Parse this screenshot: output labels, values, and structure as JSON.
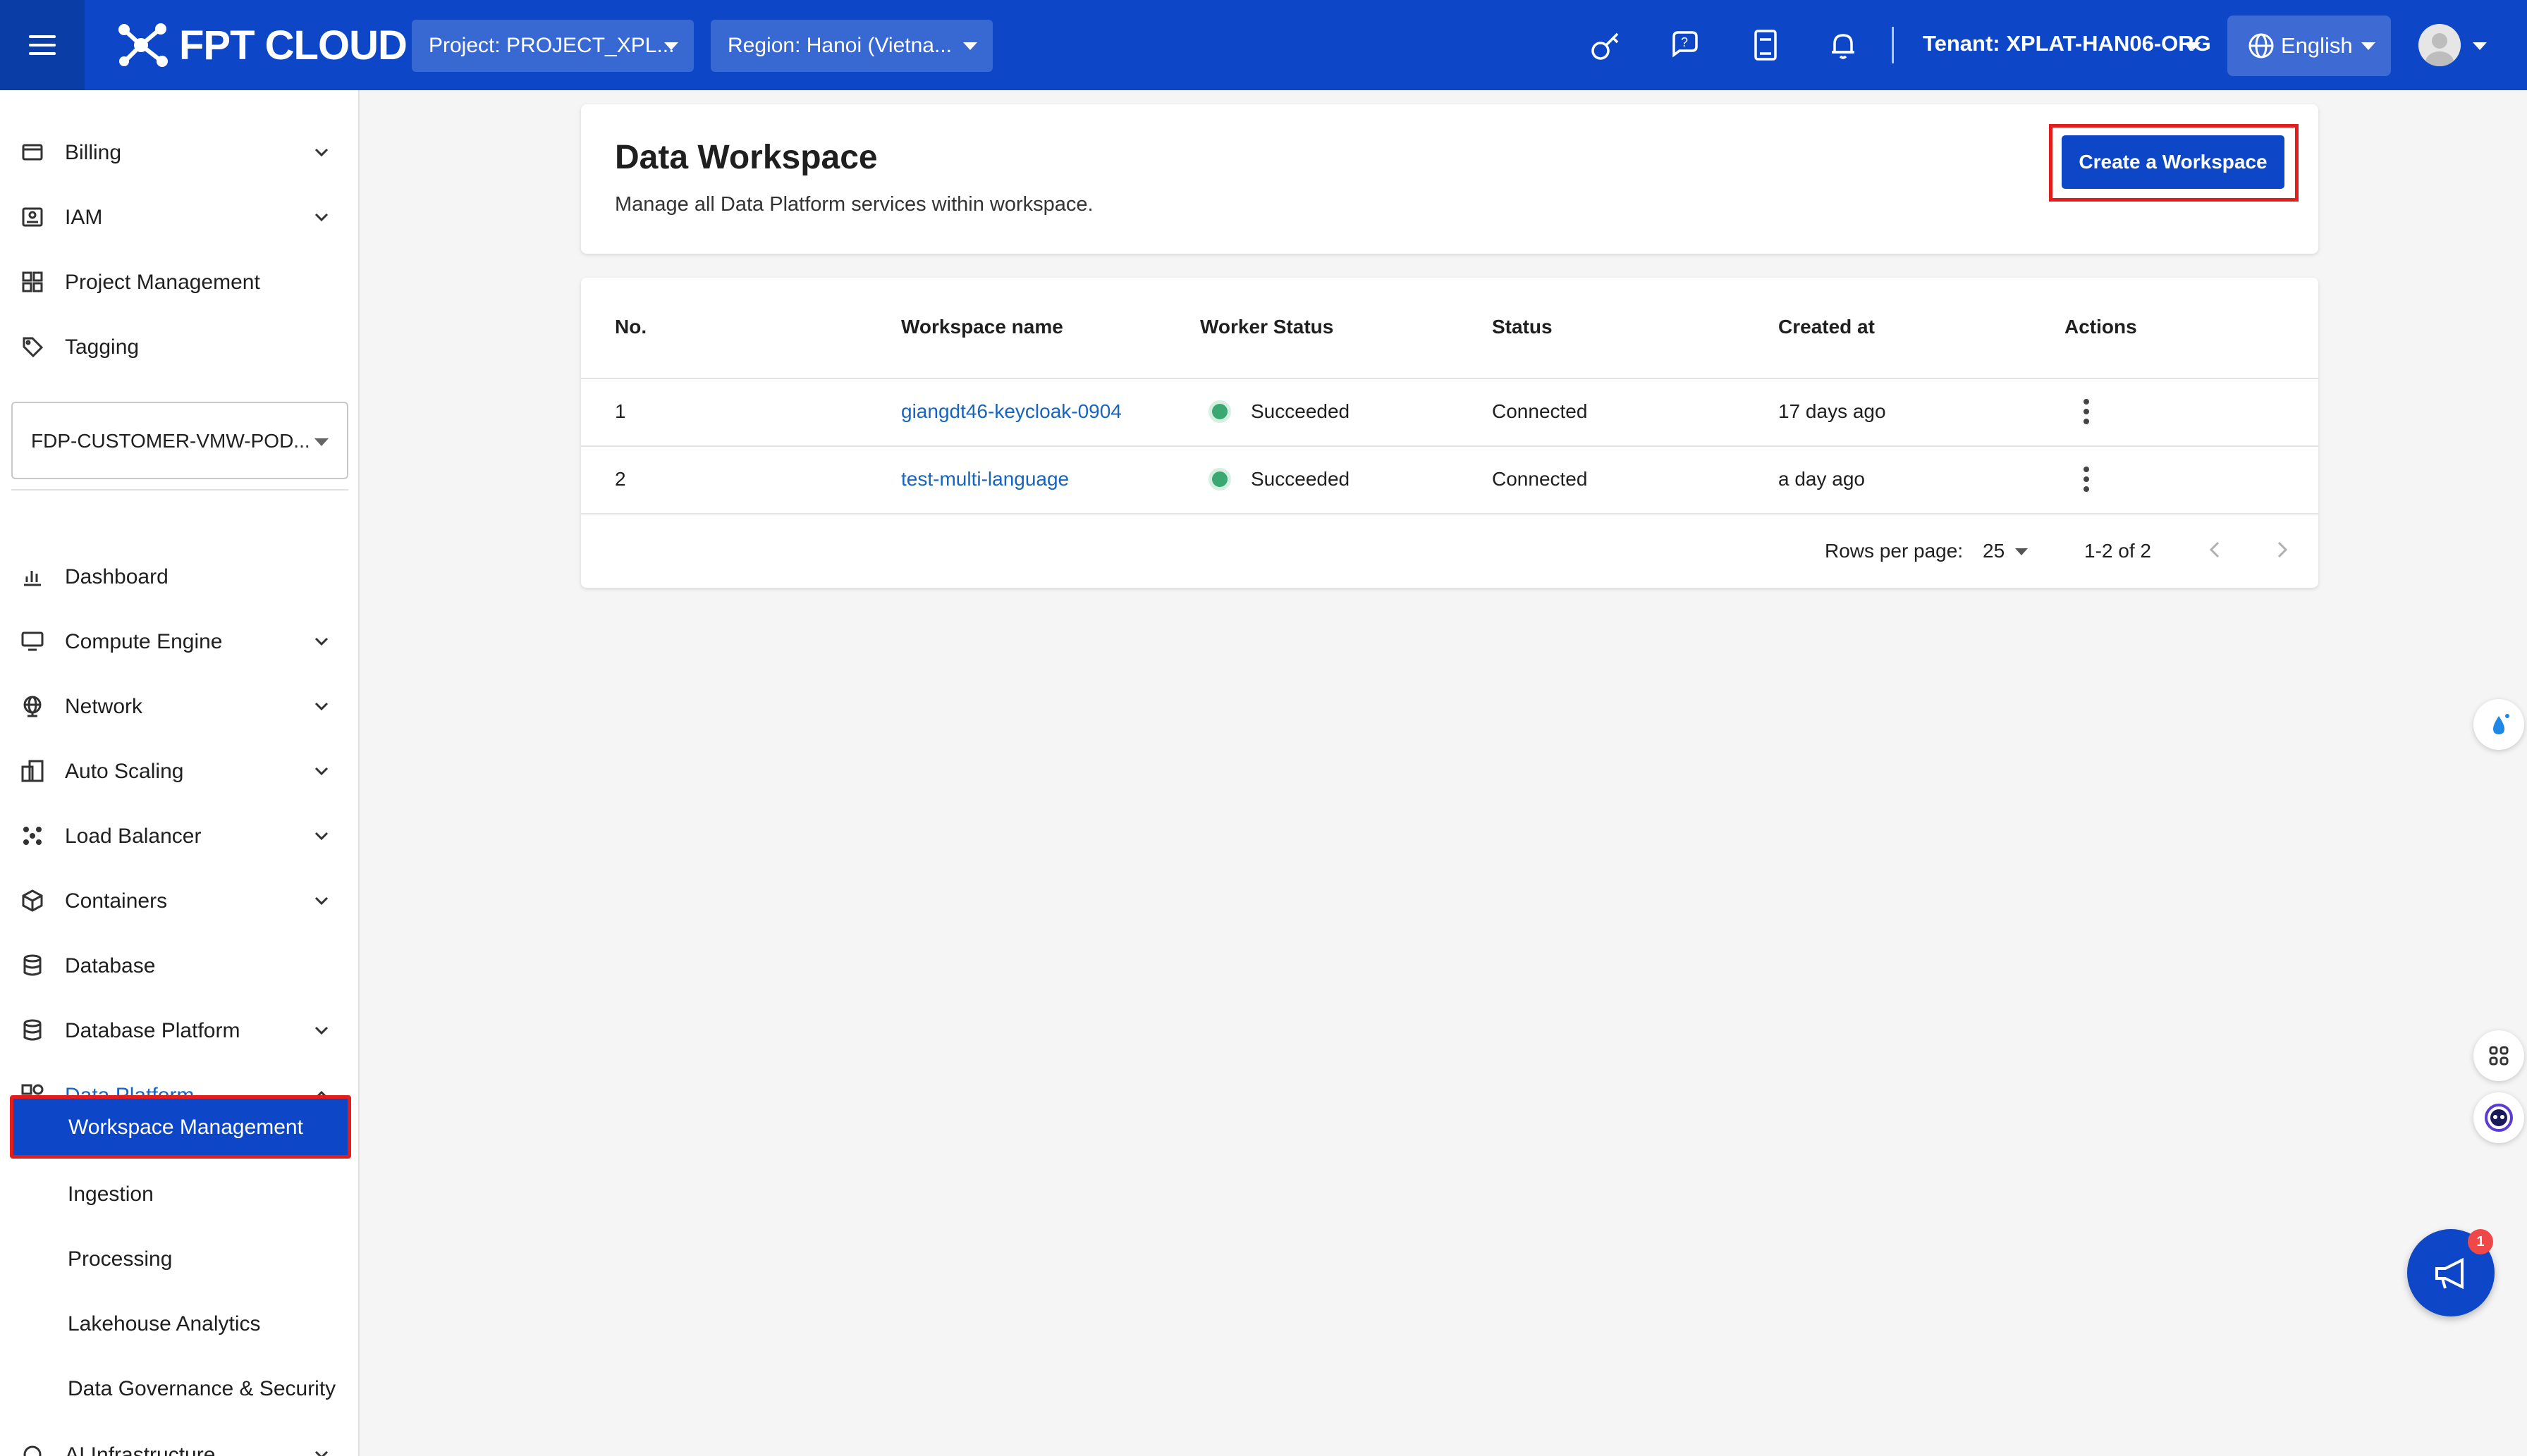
{
  "header": {
    "logo_text": "FPT CLOUD",
    "project_select": "Project: PROJECT_XPL...",
    "region_select": "Region: Hanoi (Vietna...",
    "tenant": "Tenant: XPLAT-HAN06-ORG",
    "language": "English",
    "brand_color": "#0d47c8"
  },
  "sidebar": {
    "top_items": [
      {
        "label": "Billing",
        "icon": "billing-icon"
      },
      {
        "label": "IAM",
        "icon": "iam-icon"
      },
      {
        "label": "Project Management",
        "icon": "project-icon"
      },
      {
        "label": "Tagging",
        "icon": "tag-icon"
      }
    ],
    "project_dropdown": "FDP-CUSTOMER-VMW-POD...",
    "items": [
      {
        "label": "Dashboard",
        "icon": "chart-icon"
      },
      {
        "label": "Compute Engine",
        "icon": "monitor-icon"
      },
      {
        "label": "Network",
        "icon": "globe-icon"
      },
      {
        "label": "Auto Scaling",
        "icon": "scaling-icon"
      },
      {
        "label": "Load Balancer",
        "icon": "load-balancer-icon"
      },
      {
        "label": "Containers",
        "icon": "box-icon"
      },
      {
        "label": "Database",
        "icon": "database-icon"
      },
      {
        "label": "Database Platform",
        "icon": "database-icon"
      },
      {
        "label": "Data Platform",
        "icon": "data-platform-icon"
      }
    ],
    "sub_items": [
      {
        "label": "Workspace Management"
      },
      {
        "label": "Ingestion"
      },
      {
        "label": "Processing"
      },
      {
        "label": "Lakehouse Analytics"
      },
      {
        "label": "Data Governance & Security"
      }
    ],
    "last_item": "AI Infrastructure"
  },
  "page": {
    "title": "Data Workspace",
    "subtitle": "Manage all Data Platform services within workspace.",
    "create_button": "Create a Workspace"
  },
  "table": {
    "columns": [
      "No.",
      "Workspace name",
      "Worker Status",
      "Status",
      "Created at",
      "Actions"
    ],
    "rows": [
      {
        "no": "1",
        "name": "giangdt46-keycloak-0904",
        "worker_status": "Succeeded",
        "status": "Connected",
        "created": "17 days ago"
      },
      {
        "no": "2",
        "name": "test-multi-language",
        "worker_status": "Succeeded",
        "status": "Connected",
        "created": "a day ago"
      }
    ],
    "rows_per_page_label": "Rows per page:",
    "rows_per_page": "25",
    "range": "1-2 of 2"
  },
  "notifications": {
    "count": "1"
  }
}
